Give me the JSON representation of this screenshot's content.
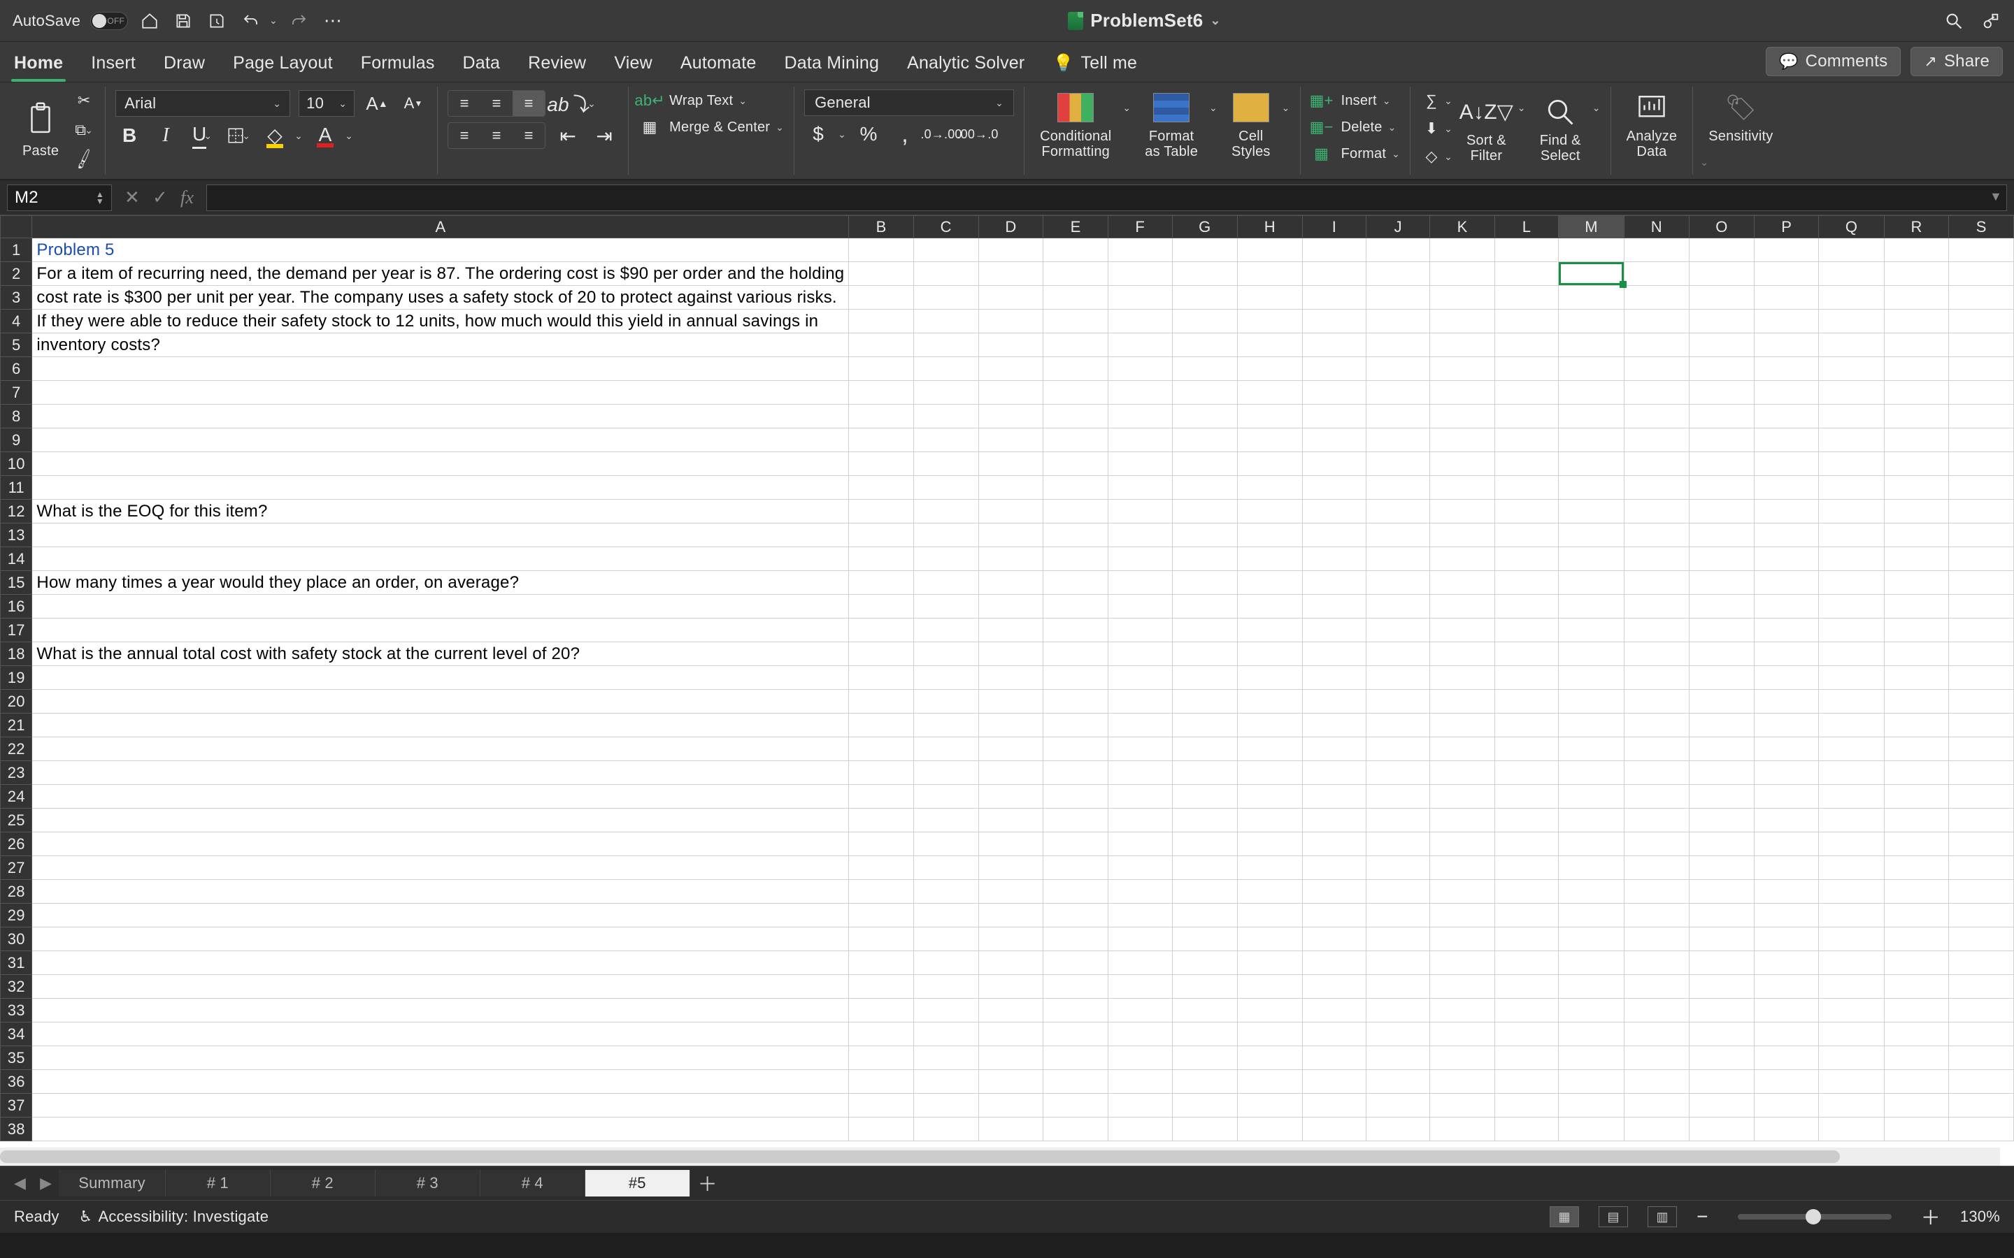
{
  "titlebar": {
    "autosave_label": "AutoSave",
    "autosave_state": "OFF",
    "doc_title": "ProblemSet6"
  },
  "ribbon_tabs": [
    "Home",
    "Insert",
    "Draw",
    "Page Layout",
    "Formulas",
    "Data",
    "Review",
    "View",
    "Automate",
    "Data Mining",
    "Analytic Solver"
  ],
  "ribbon_tabs_active": "Home",
  "tell_me": "Tell me",
  "comments_label": "Comments",
  "share_label": "Share",
  "ribbon": {
    "paste_label": "Paste",
    "font_name": "Arial",
    "font_size": "10",
    "wrap_text": "Wrap Text",
    "merge_center": "Merge & Center",
    "number_format": "General",
    "cond_fmt": "Conditional\nFormatting",
    "fmt_table": "Format\nas Table",
    "cell_styles": "Cell\nStyles",
    "insert": "Insert",
    "delete": "Delete",
    "format": "Format",
    "sort_filter": "Sort &\nFilter",
    "find_select": "Find &\nSelect",
    "analyze": "Analyze\nData",
    "sensitivity": "Sensitivity"
  },
  "name_box": "M2",
  "columns": [
    "A",
    "B",
    "C",
    "D",
    "E",
    "F",
    "G",
    "H",
    "I",
    "J",
    "K",
    "L",
    "M",
    "N",
    "O",
    "P",
    "Q",
    "R",
    "S"
  ],
  "selected_col": "M",
  "selected_row": 2,
  "row_count": 38,
  "cells": {
    "A1": {
      "text": "Problem 5",
      "class": "blue"
    },
    "A2": {
      "text": "For a item of recurring need, the demand per year is 87.  The ordering cost is $90 per order and the holding"
    },
    "A3": {
      "text": "cost rate is $300 per unit per year.  The company uses a safety stock of 20 to protect against various risks."
    },
    "A4": {
      "text": "If they were able to reduce their safety stock to 12 units, how much would this yield in annual savings in"
    },
    "A5": {
      "text": "inventory costs?"
    },
    "A12": {
      "text": "What is the EOQ for this item?"
    },
    "A15": {
      "text": "How many times a year would they place an order, on average?"
    },
    "A18": {
      "text": "What is the annual total cost with safety stock at the current level of 20?"
    }
  },
  "sheets": [
    "Summary",
    "# 1",
    "# 2",
    "# 3",
    "# 4",
    "#5"
  ],
  "active_sheet": "#5",
  "status": {
    "ready": "Ready",
    "accessibility": "Accessibility: Investigate",
    "zoom": "130%"
  }
}
